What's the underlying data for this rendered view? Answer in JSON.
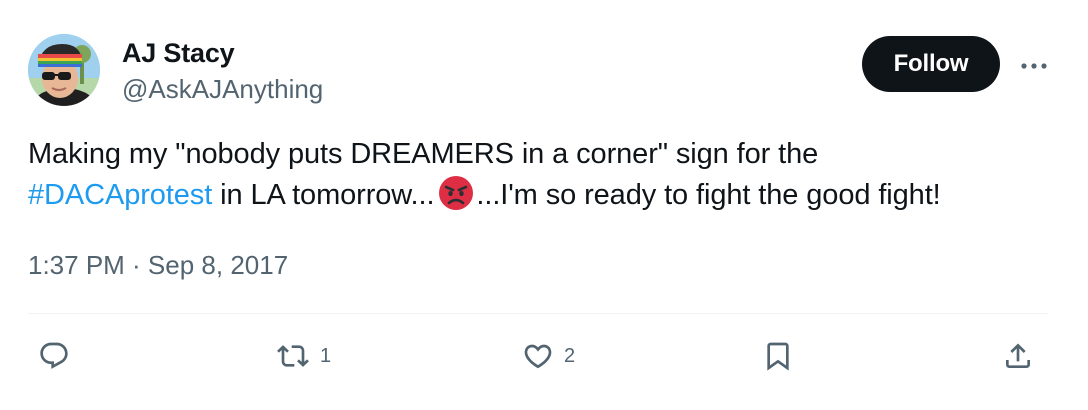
{
  "author": {
    "display_name": "AJ Stacy",
    "handle": "@AskAJAnything",
    "avatar_icon": "profile-photo"
  },
  "header": {
    "follow_label": "Follow",
    "more_icon": "more-horizontal-icon"
  },
  "tweet": {
    "text_before": "Making my \"nobody puts DREAMERS in a corner\" sign for the ",
    "hashtag": "#DACAprotest",
    "text_middle": " in LA tomorrow...",
    "emoji": "angry-face-emoji",
    "text_after": "...I'm so ready to fight the good fight!",
    "timestamp": "1:37 PM · Sep 8, 2017"
  },
  "actions": {
    "reply": {
      "icon": "reply-icon",
      "count": ""
    },
    "retweet": {
      "icon": "retweet-icon",
      "count": "1"
    },
    "like": {
      "icon": "heart-icon",
      "count": "2"
    },
    "bookmark": {
      "icon": "bookmark-icon",
      "count": ""
    },
    "share": {
      "icon": "share-icon",
      "count": ""
    }
  },
  "colors": {
    "link": "#1d9bf0",
    "secondary_text": "#536471",
    "primary_text": "#0f1419",
    "follow_bg": "#0f1419",
    "divider": "#eff3f4"
  }
}
